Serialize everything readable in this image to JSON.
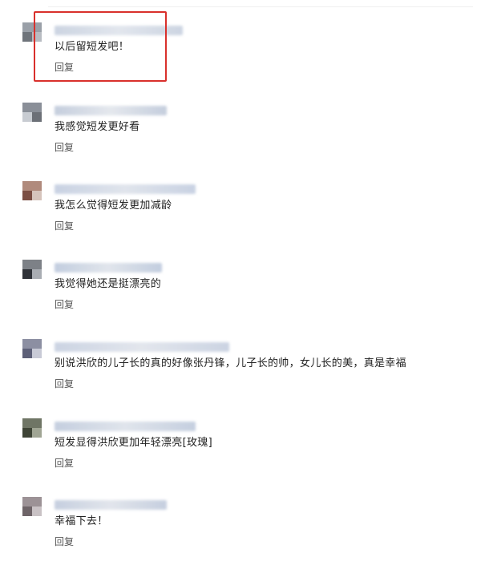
{
  "comments": [
    {
      "text": "以后留短发吧！",
      "reply_label": "回复",
      "avatar_colors": [
        "#9aa0a8",
        "#6f747b",
        "#b8bcc2"
      ],
      "nick_colors": [
        "#c7d0df",
        "#dfe4ec"
      ]
    },
    {
      "text": "我感觉短发更好看",
      "reply_label": "回复",
      "avatar_colors": [
        "#8a8f98",
        "#c8ccd2",
        "#6c7077"
      ],
      "nick_colors": [
        "#bfc9da",
        "#e2e6ec"
      ]
    },
    {
      "text": "我怎么觉得短发更加减龄",
      "reply_label": "回复",
      "avatar_colors": [
        "#b08a7c",
        "#7c4f44",
        "#d6c4bc"
      ],
      "nick_colors": [
        "#c3cde0",
        "#dde2ea"
      ]
    },
    {
      "text": "我觉得她还是挺漂亮的",
      "reply_label": "回复",
      "avatar_colors": [
        "#7d8187",
        "#2f3238",
        "#a9adb3"
      ],
      "nick_colors": [
        "#bcc8dc",
        "#dee3ea"
      ]
    },
    {
      "text": "别说洪欣的儿子长的真的好像张丹锋，儿子长的帅，女儿长的美，真是幸福",
      "reply_label": "回复",
      "avatar_colors": [
        "#8c8fa2",
        "#5d6078",
        "#c8cad6"
      ],
      "nick_colors": [
        "#c6cfe0",
        "#e0e4eb"
      ]
    },
    {
      "text": "短发显得洪欣更加年轻漂亮[玫瑰]",
      "reply_label": "回复",
      "avatar_colors": [
        "#6f7565",
        "#3e4436",
        "#a0a594"
      ],
      "nick_colors": [
        "#bfcadc",
        "#dde2ea"
      ]
    },
    {
      "text": "幸福下去！",
      "reply_label": "回复",
      "avatar_colors": [
        "#9c9296",
        "#6e6468",
        "#c9c2c5"
      ],
      "nick_colors": [
        "#c0cadc",
        "#dfe3ea"
      ]
    }
  ],
  "highlight_color": "#d9302c"
}
